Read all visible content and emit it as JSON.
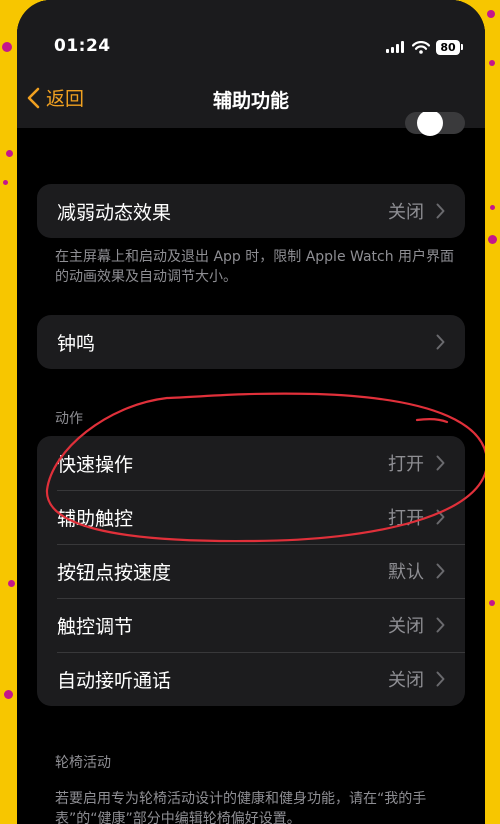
{
  "status_bar": {
    "time": "01:24",
    "battery": "80"
  },
  "nav": {
    "back_label": "返回",
    "title": "辅助功能"
  },
  "reduce_motion": {
    "label": "减弱动态效果",
    "value": "关闭",
    "footer": "在主屏幕上和启动及退出 App 时，限制 Apple Watch 用户界面的动画效果及自动调节大小。"
  },
  "chimes": {
    "label": "钟鸣"
  },
  "motion_section": {
    "header": "动作",
    "items": [
      {
        "label": "快速操作",
        "value": "打开"
      },
      {
        "label": "辅助触控",
        "value": "打开"
      },
      {
        "label": "按钮点按速度",
        "value": "默认"
      },
      {
        "label": "触控调节",
        "value": "关闭"
      },
      {
        "label": "自动接听通话",
        "value": "关闭"
      }
    ]
  },
  "wheelchair_section": {
    "header": "轮椅活动",
    "footer": "若要启用专为轮椅活动设计的健康和健身功能，请在“我的手表”的“健康”部分中编辑轮椅偏好设置。"
  },
  "colors": {
    "accent": "#f0a020",
    "background": "#000000",
    "cell": "#1c1c1e",
    "secondary_text": "#8e8e93",
    "annotation": "#e0303a",
    "backdrop": "#f7c600"
  }
}
